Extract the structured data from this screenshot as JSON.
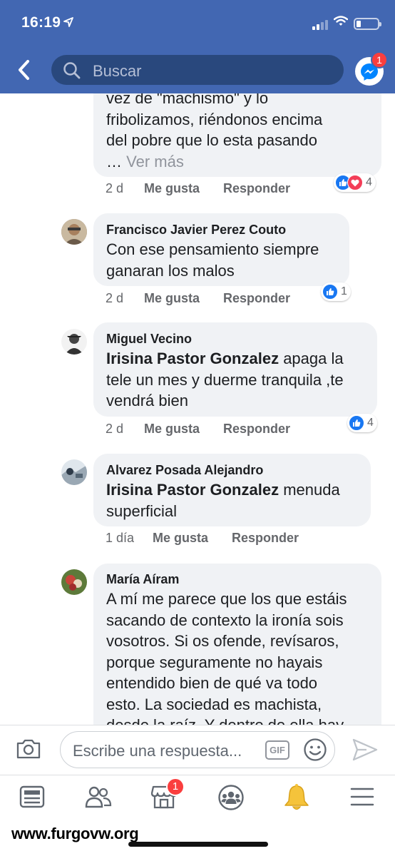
{
  "status": {
    "time": "16:19"
  },
  "header": {
    "search_placeholder": "Buscar",
    "messenger_badge": "1"
  },
  "comments": [
    {
      "name": "",
      "text": "vez de \"machismo\" y lo\nfribolizamos, riéndonos encima\ndel pobre que lo esta pasando\n…",
      "see_more": "Ver más",
      "time": "2 d",
      "like": "Me gusta",
      "reply": "Responder",
      "reactions": [
        "like",
        "love"
      ],
      "reaction_count": "4"
    },
    {
      "name": "Francisco Javier Perez Couto",
      "text": "Con ese pensamiento siempre\nganaran los malos",
      "time": "2 d",
      "like": "Me gusta",
      "reply": "Responder",
      "reactions": [
        "like"
      ],
      "reaction_count": "1"
    },
    {
      "name": "Miguel Vecino",
      "mention": "Irisina Pastor Gonzalez",
      "text": " apaga la\ntele un mes y duerme tranquila ,te\nvendrá bien",
      "time": "2 d",
      "like": "Me gusta",
      "reply": "Responder",
      "reactions": [
        "like"
      ],
      "reaction_count": "4"
    },
    {
      "name": "Alvarez Posada Alejandro",
      "mention": "Irisina Pastor Gonzalez",
      "text": "  menuda\nsuperficial",
      "time": "1 día",
      "like": "Me gusta",
      "reply": "Responder"
    },
    {
      "name": "María Aíram",
      "text": "A mí me parece que los que estáis\nsacando de contexto la ironía sois\nvosotros. Si os ofende, revísaros,\nporque seguramente no hayais\nentendido bien de qué va todo\nesto. La sociedad es machista,\ndesde la raíz. Y dentro de ella hay"
    }
  ],
  "reply_bar": {
    "placeholder": "Escribe una respuesta...",
    "gif_label": "GIF"
  },
  "tabbar": {
    "tabs": [
      "news-feed-icon",
      "friends-icon",
      "marketplace-icon",
      "groups-icon",
      "notifications-icon",
      "menu-icon"
    ],
    "marketplace_badge": "1"
  },
  "watermark": "www.furgovw.org",
  "colors": {
    "header": "#4267b2",
    "like": "#1877f2",
    "love": "#f33e58",
    "badge": "#fa3e3e",
    "bell": "#f5c33b"
  }
}
